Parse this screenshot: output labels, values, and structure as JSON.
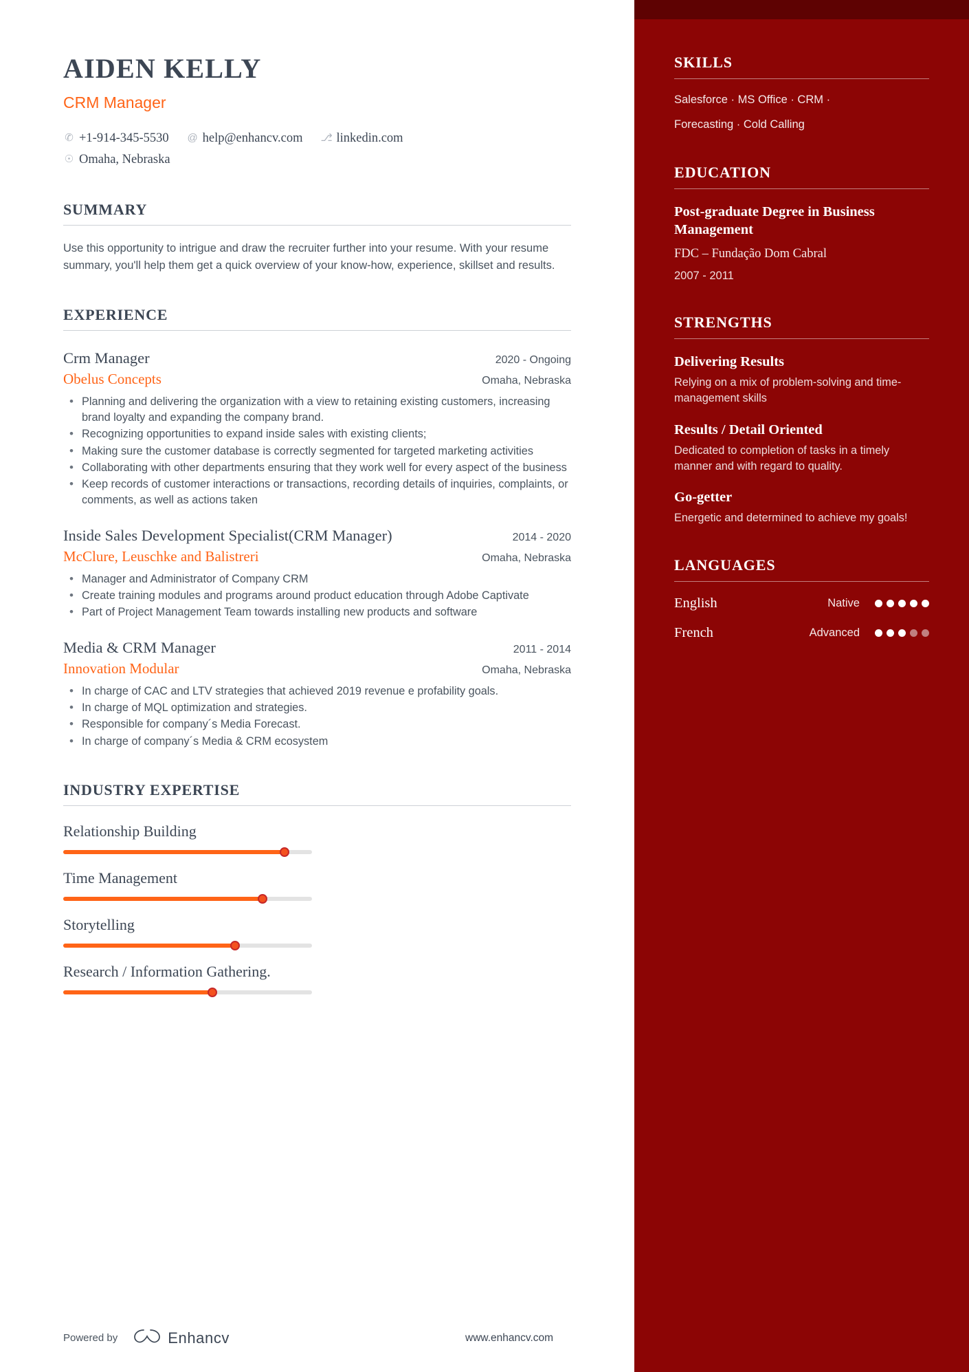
{
  "header": {
    "name": "AIDEN KELLY",
    "title": "CRM Manager",
    "contacts": [
      {
        "icon": "phone-icon",
        "glyph": "✆",
        "text": "+1-914-345-5530"
      },
      {
        "icon": "email-icon",
        "glyph": "@",
        "text": "help@enhancv.com"
      },
      {
        "icon": "link-icon",
        "glyph": "⎇",
        "text": "linkedin.com"
      }
    ],
    "location": {
      "icon": "location-pin-icon",
      "glyph": "☉",
      "text": "Omaha, Nebraska"
    }
  },
  "summary": {
    "heading": "SUMMARY",
    "text": "Use this opportunity to intrigue and draw the recruiter further into your resume. With your resume summary, you'll help them get a quick overview of your know-how, experience, skillset and results."
  },
  "experience": {
    "heading": "EXPERIENCE",
    "jobs": [
      {
        "role": "Crm Manager",
        "dates": "2020 - Ongoing",
        "company": "Obelus Concepts",
        "location": "Omaha, Nebraska",
        "bullets": [
          "Planning and delivering the organization with a view to retaining existing customers, increasing brand loyalty and expanding the company brand.",
          "Recognizing opportunities to expand inside sales with existing clients;",
          "Making sure the customer database is correctly segmented for targeted marketing activities",
          "Collaborating with other departments ensuring that they work well for every aspect of the business",
          "Keep records of customer interactions or transactions, recording details of inquiries, complaints, or comments, as well as actions taken"
        ]
      },
      {
        "role": "Inside Sales Development Specialist(CRM Manager)",
        "dates": "2014 - 2020",
        "company": "McClure, Leuschke and Balistreri",
        "location": "Omaha, Nebraska",
        "bullets": [
          "Manager and Administrator of Company CRM",
          "Create training modules and programs around product education through Adobe Captivate",
          "Part of Project Management Team towards installing new products and software"
        ]
      },
      {
        "role": "Media & CRM Manager",
        "dates": "2011 - 2014",
        "company": "Innovation Modular",
        "location": "Omaha, Nebraska",
        "bullets": [
          "In charge of CAC and LTV strategies that achieved 2019 revenue e profability goals.",
          "In charge of MQL optimization and strategies.",
          "Responsible for company´s Media Forecast.",
          "In charge of company´s Media & CRM ecosystem"
        ]
      }
    ]
  },
  "industry_expertise": {
    "heading": "INDUSTRY EXPERTISE",
    "items": [
      {
        "label": "Relationship Building",
        "percent": 89
      },
      {
        "label": "Time Management",
        "percent": 80
      },
      {
        "label": "Storytelling",
        "percent": 69
      },
      {
        "label": "Research / Information Gathering.",
        "percent": 60
      }
    ]
  },
  "footer": {
    "powered_by": "Powered by",
    "brand": "Enhancv",
    "url": "www.enhancv.com"
  },
  "sidebar": {
    "skills": {
      "heading": "SKILLS",
      "lines": [
        "Salesforce · MS Office · CRM ·",
        "Forecasting · Cold Calling"
      ]
    },
    "education": {
      "heading": "EDUCATION",
      "entries": [
        {
          "degree": "Post-graduate Degree in Business Management",
          "school": "FDC – Fundação Dom Cabral",
          "dates": "2007 - 2011"
        }
      ]
    },
    "strengths": {
      "heading": "STRENGTHS",
      "items": [
        {
          "title": "Delivering Results",
          "description": "Relying on a mix of problem-solving and time-management skills"
        },
        {
          "title": "Results / Detail Oriented",
          "description": "Dedicated to completion of tasks in a timely manner and with regard to quality."
        },
        {
          "title": "Go-getter",
          "description": "Energetic and determined to achieve my goals!"
        }
      ]
    },
    "languages": {
      "heading": "LANGUAGES",
      "items": [
        {
          "name": "English",
          "level": "Native",
          "dots_filled": 5,
          "dots_total": 5
        },
        {
          "name": "French",
          "level": "Advanced",
          "dots_filled": 3,
          "dots_total": 5
        }
      ]
    }
  },
  "colors": {
    "sidebar_bg": "#8c0505",
    "sidebar_topbar": "#5e0202",
    "accent_orange": "#ff6417",
    "text_dark": "#3c4654"
  }
}
